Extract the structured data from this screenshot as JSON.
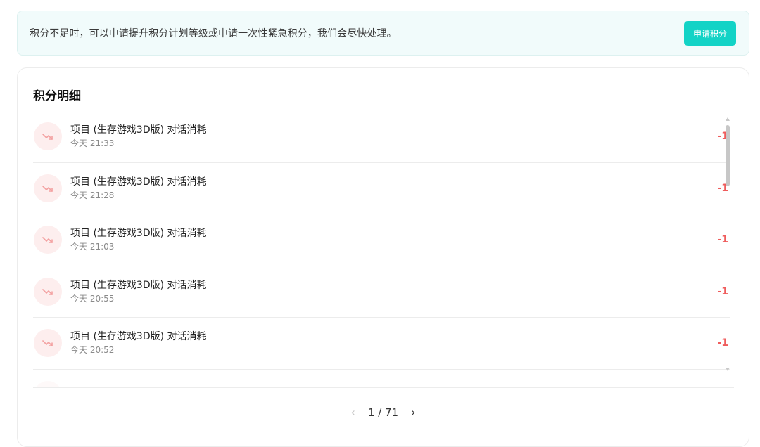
{
  "notice": {
    "text": "积分不足时，可以申请提升积分计划等级或申请一次性紧急积分，我们会尽快处理。",
    "button_label": "申请积分"
  },
  "points_detail": {
    "title": "积分明细",
    "items": [
      {
        "title": "项目 (生存游戏3D版) 对话消耗",
        "time": "今天 21:33",
        "amount": "-1"
      },
      {
        "title": "项目 (生存游戏3D版) 对话消耗",
        "time": "今天 21:28",
        "amount": "-1"
      },
      {
        "title": "项目 (生存游戏3D版) 对话消耗",
        "time": "今天 21:03",
        "amount": "-1"
      },
      {
        "title": "项目 (生存游戏3D版) 对话消耗",
        "time": "今天 20:55",
        "amount": "-1"
      },
      {
        "title": "项目 (生存游戏3D版) 对话消耗",
        "time": "今天 20:52",
        "amount": "-1"
      }
    ]
  },
  "pagination": {
    "current": "1",
    "total": "71",
    "display": "1 / 71",
    "prev_icon": "chevron-left-icon",
    "next_icon": "chevron-right-icon"
  },
  "colors": {
    "accent": "#13d3c6",
    "notice_bg": "#f1fbfb",
    "negative": "#ef5c5c",
    "icon_bg": "#fdeeee"
  }
}
